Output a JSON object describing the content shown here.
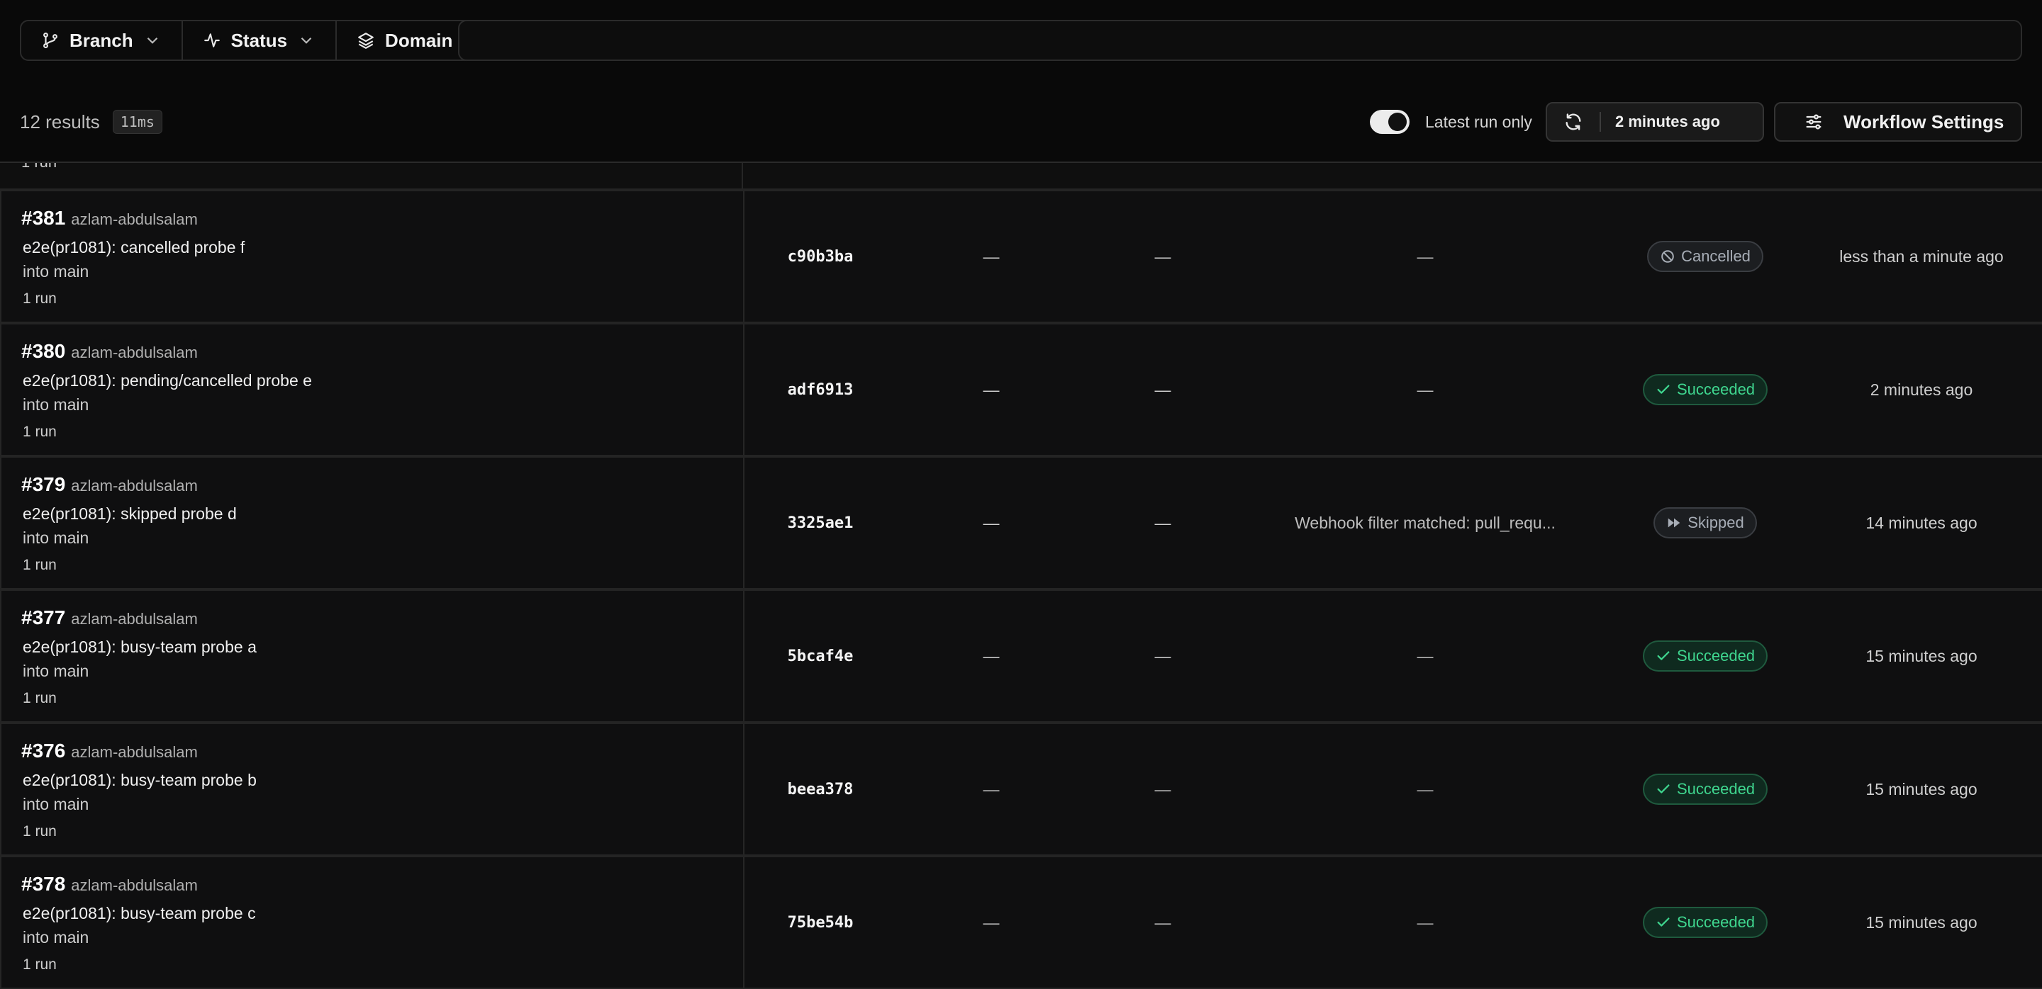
{
  "filters": {
    "branch_label": "Branch",
    "status_label": "Status",
    "domain_label": "Domain",
    "search_placeholder": ""
  },
  "results": {
    "count_label": "12 results",
    "timing": "11ms"
  },
  "controls": {
    "latest_run_label": "Latest run only",
    "latest_run_on": true,
    "refresh_label": "2 minutes ago",
    "workflow_settings_label": "Workflow Settings"
  },
  "partial_row": {
    "runs": "1 run"
  },
  "rows": [
    {
      "number": "#381",
      "author": "azlam-abdulsalam",
      "title": "e2e(pr1081): cancelled probe f",
      "branch": "into main",
      "runs": "1 run",
      "sha": "c90b3ba",
      "col1": "—",
      "col2": "—",
      "message": "—",
      "status": "Cancelled",
      "status_kind": "cancelled",
      "time": "less than a minute ago"
    },
    {
      "number": "#380",
      "author": "azlam-abdulsalam",
      "title": "e2e(pr1081): pending/cancelled probe e",
      "branch": "into main",
      "runs": "1 run",
      "sha": "adf6913",
      "col1": "—",
      "col2": "—",
      "message": "—",
      "status": "Succeeded",
      "status_kind": "succeeded",
      "time": "2 minutes ago"
    },
    {
      "number": "#379",
      "author": "azlam-abdulsalam",
      "title": "e2e(pr1081): skipped probe d",
      "branch": "into main",
      "runs": "1 run",
      "sha": "3325ae1",
      "col1": "—",
      "col2": "—",
      "message": "Webhook filter matched: pull_requ...",
      "status": "Skipped",
      "status_kind": "skipped",
      "time": "14 minutes ago"
    },
    {
      "number": "#377",
      "author": "azlam-abdulsalam",
      "title": "e2e(pr1081): busy-team probe a",
      "branch": "into main",
      "runs": "1 run",
      "sha": "5bcaf4e",
      "col1": "—",
      "col2": "—",
      "message": "—",
      "status": "Succeeded",
      "status_kind": "succeeded",
      "time": "15 minutes ago"
    },
    {
      "number": "#376",
      "author": "azlam-abdulsalam",
      "title": "e2e(pr1081): busy-team probe b",
      "branch": "into main",
      "runs": "1 run",
      "sha": "beea378",
      "col1": "—",
      "col2": "—",
      "message": "—",
      "status": "Succeeded",
      "status_kind": "succeeded",
      "time": "15 minutes ago"
    },
    {
      "number": "#378",
      "author": "azlam-abdulsalam",
      "title": "e2e(pr1081): busy-team probe c",
      "branch": "into main",
      "runs": "1 run",
      "sha": "75be54b",
      "col1": "—",
      "col2": "—",
      "message": "—",
      "status": "Succeeded",
      "status_kind": "succeeded",
      "time": "15 minutes ago"
    }
  ],
  "colors": {
    "background": "#090909",
    "success": "#3fd68f",
    "neutral_badge": "#a7adb6"
  }
}
